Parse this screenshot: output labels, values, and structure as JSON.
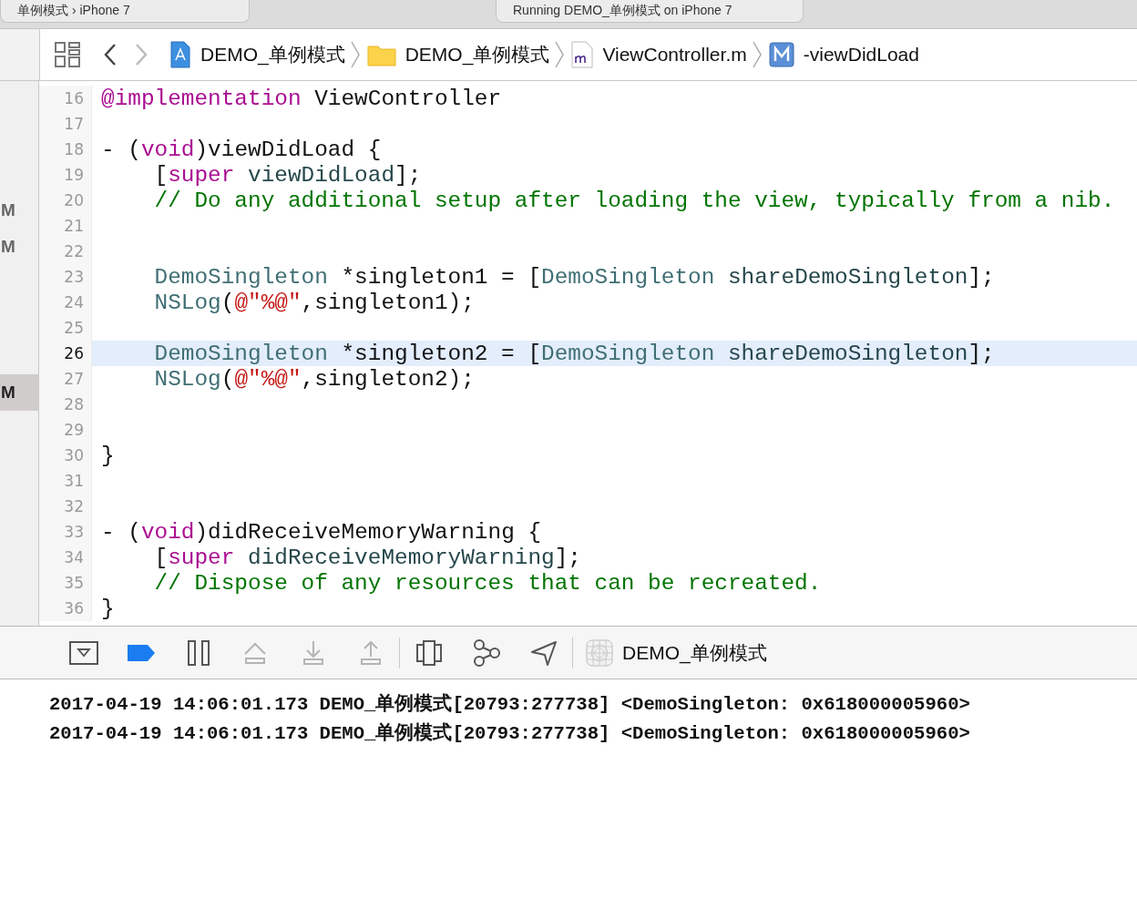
{
  "tabs": [
    {
      "label": "单例模式 › iPhone 7"
    },
    {
      "label": "Running DEMO_单例模式 on iPhone 7"
    }
  ],
  "jump_bar": {
    "back": {
      "disabled": false
    },
    "forward": {
      "disabled": true
    },
    "path": [
      {
        "kind": "project",
        "label": "DEMO_单例模式"
      },
      {
        "kind": "folder",
        "label": "DEMO_单例模式"
      },
      {
        "kind": "file",
        "label": "ViewController.m"
      },
      {
        "kind": "method",
        "label": "-viewDidLoad"
      }
    ]
  },
  "sidebar": {
    "items": [
      {
        "badge": "M",
        "selected": false
      },
      {
        "badge": "M",
        "selected": false
      },
      {
        "badge": "M",
        "selected": true
      }
    ]
  },
  "editor": {
    "lines": [
      {
        "number": "16",
        "current": false,
        "tokens": [
          {
            "text": "@implementation",
            "kind": "keyword"
          },
          {
            "text": " ViewController",
            "kind": "plain"
          }
        ]
      },
      {
        "number": "17",
        "current": false
      },
      {
        "number": "18",
        "current": false,
        "tokens": [
          {
            "text": "- (",
            "kind": "plain"
          },
          {
            "text": "void",
            "kind": "keyword"
          },
          {
            "text": ")viewDidLoad {",
            "kind": "plain"
          }
        ]
      },
      {
        "number": "19",
        "current": false,
        "tokens": [
          {
            "text": "    [",
            "kind": "plain"
          },
          {
            "text": "super",
            "kind": "keyword"
          },
          {
            "text": " viewDidLoad",
            "kind": "method"
          },
          {
            "text": "];",
            "kind": "plain"
          }
        ]
      },
      {
        "number": "20",
        "current": false,
        "tokens": [
          {
            "text": "    // Do any additional setup after loading the view, typically from a nib.",
            "kind": "comment"
          }
        ]
      },
      {
        "number": "21",
        "current": false
      },
      {
        "number": "22",
        "current": false
      },
      {
        "number": "23",
        "current": false,
        "tokens": [
          {
            "text": "    DemoSingleton",
            "kind": "class"
          },
          {
            "text": " *singleton1 = [",
            "kind": "plain"
          },
          {
            "text": "DemoSingleton",
            "kind": "class"
          },
          {
            "text": " shareDemoSingleton",
            "kind": "method"
          },
          {
            "text": "];",
            "kind": "plain"
          }
        ]
      },
      {
        "number": "24",
        "current": false,
        "tokens": [
          {
            "text": "    NSLog",
            "kind": "class"
          },
          {
            "text": "(",
            "kind": "plain"
          },
          {
            "text": "@\"%@\"",
            "kind": "string"
          },
          {
            "text": ",singleton1);",
            "kind": "plain"
          }
        ]
      },
      {
        "number": "25",
        "current": false
      },
      {
        "number": "26",
        "current": true,
        "tokens": [
          {
            "text": "    DemoSingleton",
            "kind": "class"
          },
          {
            "text": " *singleton2 = [",
            "kind": "plain"
          },
          {
            "text": "DemoSingleton",
            "kind": "class"
          },
          {
            "text": " shareDemoSingleton",
            "kind": "method"
          },
          {
            "text": "];",
            "kind": "plain"
          }
        ]
      },
      {
        "number": "27",
        "current": false,
        "tokens": [
          {
            "text": "    NSLog",
            "kind": "class"
          },
          {
            "text": "(",
            "kind": "plain"
          },
          {
            "text": "@\"%@\"",
            "kind": "string"
          },
          {
            "text": ",singleton2);",
            "kind": "plain"
          }
        ]
      },
      {
        "number": "28",
        "current": false
      },
      {
        "number": "29",
        "current": false
      },
      {
        "number": "30",
        "current": false,
        "tokens": [
          {
            "text": "}",
            "kind": "plain"
          }
        ]
      },
      {
        "number": "31",
        "current": false
      },
      {
        "number": "32",
        "current": false
      },
      {
        "number": "33",
        "current": false,
        "tokens": [
          {
            "text": "- (",
            "kind": "plain"
          },
          {
            "text": "void",
            "kind": "keyword"
          },
          {
            "text": ")didReceiveMemoryWarning {",
            "kind": "plain"
          }
        ]
      },
      {
        "number": "34",
        "current": false,
        "tokens": [
          {
            "text": "    [",
            "kind": "plain"
          },
          {
            "text": "super",
            "kind": "keyword"
          },
          {
            "text": " didReceiveMemoryWarning",
            "kind": "method"
          },
          {
            "text": "];",
            "kind": "plain"
          }
        ]
      },
      {
        "number": "35",
        "current": false,
        "tokens": [
          {
            "text": "    // Dispose of any resources that can be recreated.",
            "kind": "comment"
          }
        ]
      },
      {
        "number": "36",
        "current": false,
        "tokens": [
          {
            "text": "}",
            "kind": "plain"
          }
        ]
      }
    ]
  },
  "debug_bar": {
    "buttons": [
      {
        "kind": "console",
        "active": false,
        "disabled": false
      },
      {
        "kind": "breakpoints",
        "active": true,
        "disabled": false
      },
      {
        "kind": "pause",
        "active": false,
        "disabled": false
      },
      {
        "kind": "step_over",
        "active": false,
        "disabled": true
      },
      {
        "kind": "step_in",
        "active": false,
        "disabled": true
      },
      {
        "kind": "step_out",
        "active": false,
        "disabled": true
      },
      {
        "kind": "view_debugger",
        "active": false,
        "disabled": false
      },
      {
        "kind": "memory_graph",
        "active": false,
        "disabled": false
      },
      {
        "kind": "location",
        "active": false,
        "disabled": false
      }
    ],
    "target": "DEMO_单例模式"
  },
  "console": {
    "lines": [
      "2017-04-19 14:06:01.173 DEMO_单例模式[20793:277738] <DemoSingleton: 0x618000005960>",
      "2017-04-19 14:06:01.173 DEMO_单例模式[20793:277738] <DemoSingleton: 0x618000005960>"
    ]
  }
}
